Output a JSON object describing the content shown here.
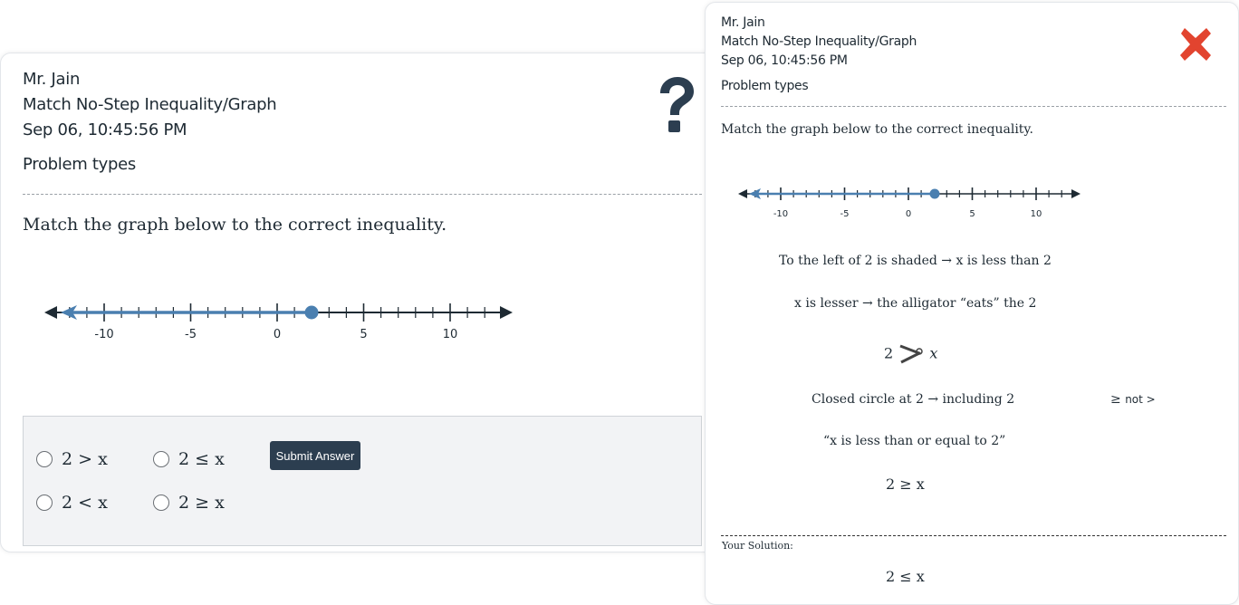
{
  "main": {
    "teacher": "Mr. Jain",
    "assignment": "Match No-Step Inequality/Graph",
    "timestamp": "Sep 06, 10:45:56 PM",
    "problem_types_link": "Problem types",
    "question": "Match the graph below to the correct inequality.",
    "number_line": {
      "ticks": [
        "-10",
        "-5",
        "0",
        "5",
        "10"
      ],
      "point": 2,
      "closed": true,
      "direction": "left",
      "range": [
        -13,
        13
      ]
    },
    "options": [
      {
        "label": "2 > x"
      },
      {
        "label": "2 ≤ x"
      },
      {
        "label": "2 < x"
      },
      {
        "label": "2 ≥ x"
      }
    ],
    "submit_label": "Submit Answer"
  },
  "solution": {
    "teacher": "Mr. Jain",
    "assignment": "Match No-Step Inequality/Graph",
    "timestamp": "Sep 06, 10:45:56 PM",
    "problem_types_link": "Problem types",
    "question": "Match the graph below to the correct inequality.",
    "number_line_ticks": [
      "-10",
      "-5",
      "0",
      "5",
      "10"
    ],
    "step1": "To the left of 2 is shaded → x is less than 2",
    "step2": "x is lesser → the alligator “eats” the 2",
    "step3_left": "2",
    "step3_right": "x",
    "step4": "Closed circle at 2 → including 2",
    "step4_note_symbol": "≥",
    "step4_note_rest": "not >",
    "step5": "“x is less than or equal to 2”",
    "step6": "2 ≥ x",
    "your_solution_label": "Your Solution:",
    "your_solution": "2 ≤ x"
  },
  "colors": {
    "accent": "#4a7fb0",
    "button": "#2c3e50",
    "close": "#e2442f",
    "help": "#2c3e50"
  }
}
